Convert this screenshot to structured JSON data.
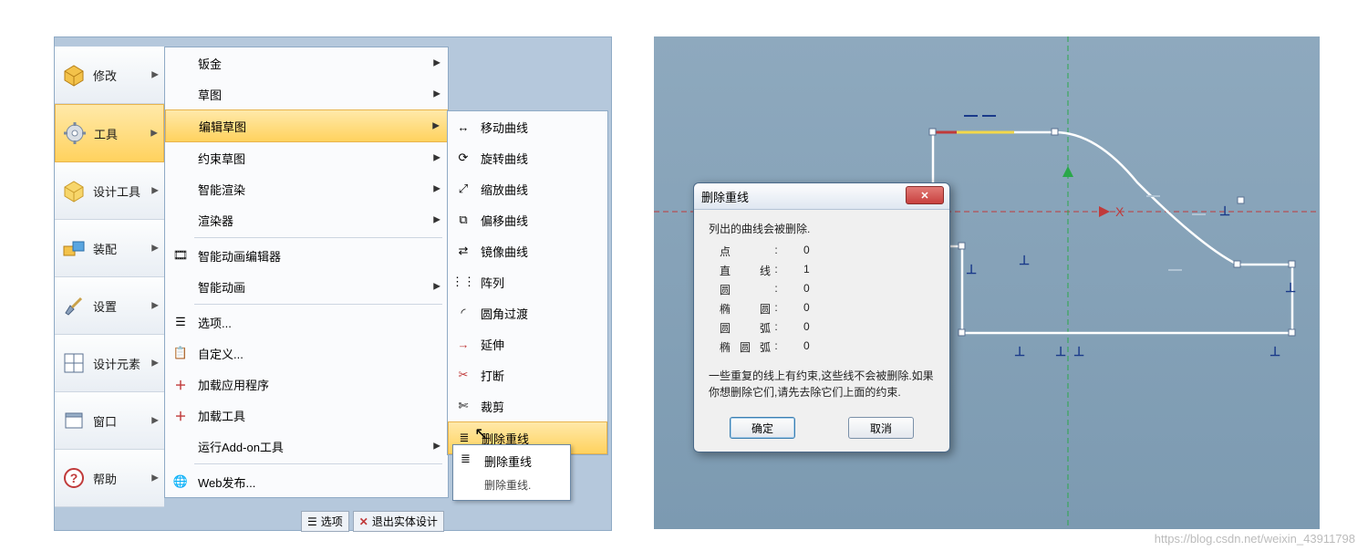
{
  "main_menu": {
    "items": [
      {
        "label": "修改"
      },
      {
        "label": "工具"
      },
      {
        "label": "设计工具"
      },
      {
        "label": "装配"
      },
      {
        "label": "设置"
      },
      {
        "label": "设计元素"
      },
      {
        "label": "窗口"
      },
      {
        "label": "帮助"
      }
    ]
  },
  "submenu1": {
    "items": [
      {
        "label": "钣金",
        "arrow": true
      },
      {
        "label": "草图",
        "arrow": true
      },
      {
        "label": "编辑草图",
        "arrow": true,
        "sel": true
      },
      {
        "label": "约束草图",
        "arrow": true
      },
      {
        "label": "智能渲染",
        "arrow": true
      },
      {
        "label": "渲染器",
        "arrow": true
      },
      {
        "label": "智能动画编辑器"
      },
      {
        "label": "智能动画",
        "arrow": true
      },
      {
        "label": "选项..."
      },
      {
        "label": "自定义..."
      },
      {
        "label": "加载应用程序"
      },
      {
        "label": "加载工具"
      },
      {
        "label": "运行Add-on工具",
        "arrow": true
      },
      {
        "label": "Web发布..."
      }
    ]
  },
  "submenu2": {
    "items": [
      {
        "label": "移动曲线"
      },
      {
        "label": "旋转曲线"
      },
      {
        "label": "缩放曲线"
      },
      {
        "label": "偏移曲线"
      },
      {
        "label": "镜像曲线"
      },
      {
        "label": "阵列"
      },
      {
        "label": "圆角过渡"
      },
      {
        "label": "延伸"
      },
      {
        "label": "打断"
      },
      {
        "label": "裁剪"
      },
      {
        "label": "删除重线",
        "sel": true
      }
    ]
  },
  "tooltip": {
    "title": "删除重线",
    "desc": "删除重线."
  },
  "bottom": {
    "opt": "选项",
    "exit": "退出实体设计"
  },
  "dialog": {
    "title": "删除重线",
    "heading": "列出的曲线会被删除.",
    "rows": [
      {
        "k": "点",
        "v": "0"
      },
      {
        "k": "直线",
        "v": "1"
      },
      {
        "k": "圆",
        "v": "0"
      },
      {
        "k": "椭圆",
        "v": "0"
      },
      {
        "k": "圆弧",
        "v": "0"
      },
      {
        "k": "椭圆弧",
        "v": "0"
      }
    ],
    "note": "一些重复的线上有约束,这些线不会被删除.如果你想删除它们,请先去除它们上面的约束.",
    "ok": "确定",
    "cancel": "取消"
  },
  "watermark": "https://blog.csdn.net/weixin_43911798",
  "axis": {
    "x": "X"
  }
}
